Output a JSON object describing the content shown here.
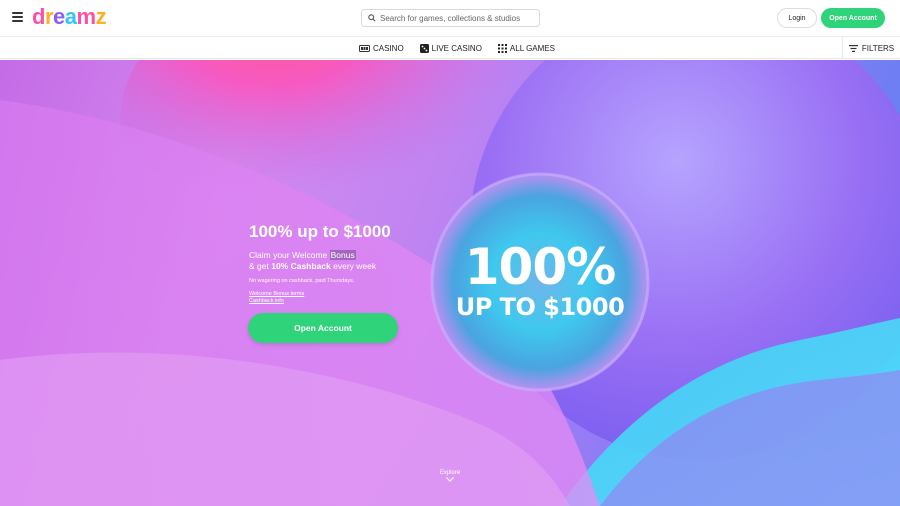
{
  "header": {
    "logo_text": "dreamz",
    "search_placeholder": "Search for games, collections & studios",
    "login_label": "Login",
    "open_account_label": "Open Account"
  },
  "nav": {
    "items": [
      {
        "label": "CASINO",
        "icon": "casino-icon"
      },
      {
        "label": "LIVE CASINO",
        "icon": "live-casino-icon"
      },
      {
        "label": "ALL GAMES",
        "icon": "grid-icon"
      }
    ],
    "filters_label": "FILTERS"
  },
  "hero": {
    "title": "100% up to $1000",
    "line1_pre": "Claim your Welcome ",
    "line1_highlight": "Bonus",
    "line2_pre": "& get ",
    "line2_bold": "10% Cashback",
    "line2_post": " every week",
    "note": "No wagering on cashback, paid Thursdays.",
    "link1": "Welcome Bonus terms",
    "link2": "Cashback info",
    "cta": "Open Account",
    "bubble_big": "100%",
    "bubble_sub": "UP TO $1000",
    "explore": "Explore"
  },
  "colors": {
    "accent_green": "#2fd37a",
    "logo": [
      "#ff4fa3",
      "#ffb020",
      "#8a5cff",
      "#2fc6ff",
      "#ff4fa3",
      "#ffb020"
    ]
  }
}
